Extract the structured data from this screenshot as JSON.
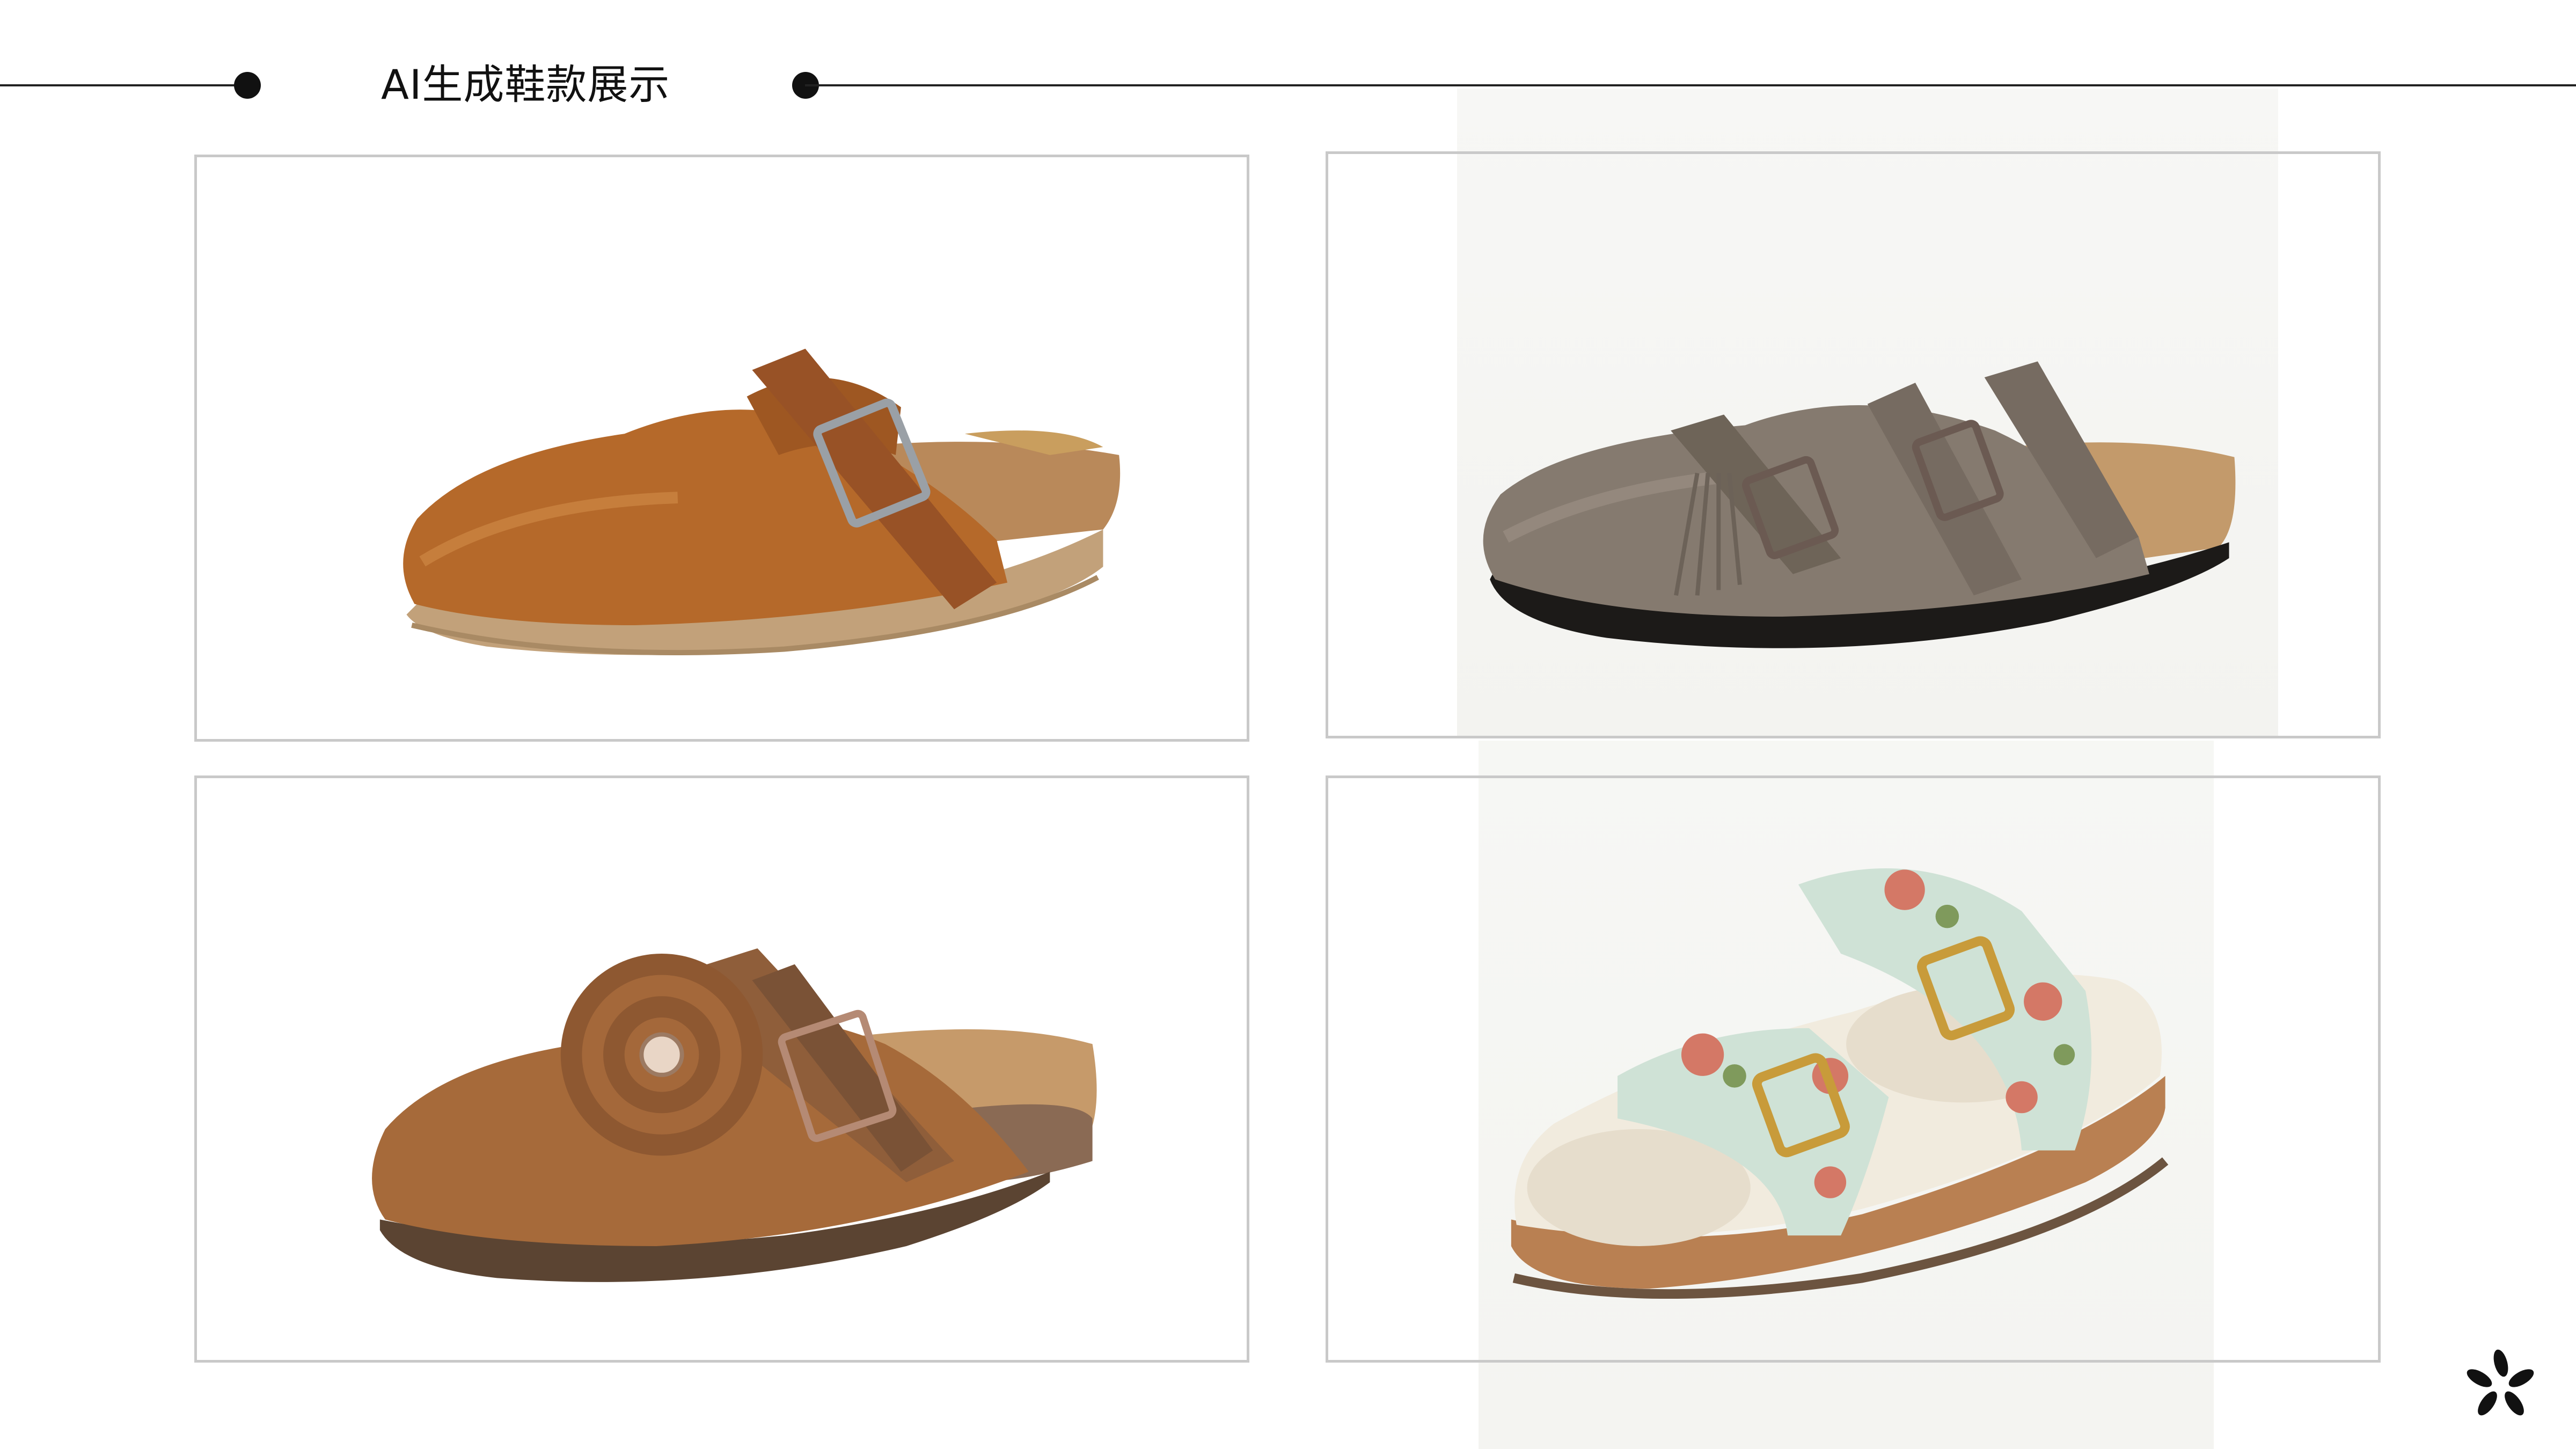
{
  "header": {
    "title": "AI生成鞋款展示"
  },
  "gallery": {
    "items": [
      {
        "icon": "brown-leather-clog-image",
        "color": "#b06a2c"
      },
      {
        "icon": "grey-suede-clog-image",
        "color": "#857a6f"
      },
      {
        "icon": "tan-suede-flower-clog-image",
        "color": "#a66a3a"
      },
      {
        "icon": "floral-shearling-sandal-image",
        "color": "#cfe2d6"
      }
    ]
  },
  "brand": {
    "icon": "asterisk-logo-icon",
    "color": "#111111"
  }
}
